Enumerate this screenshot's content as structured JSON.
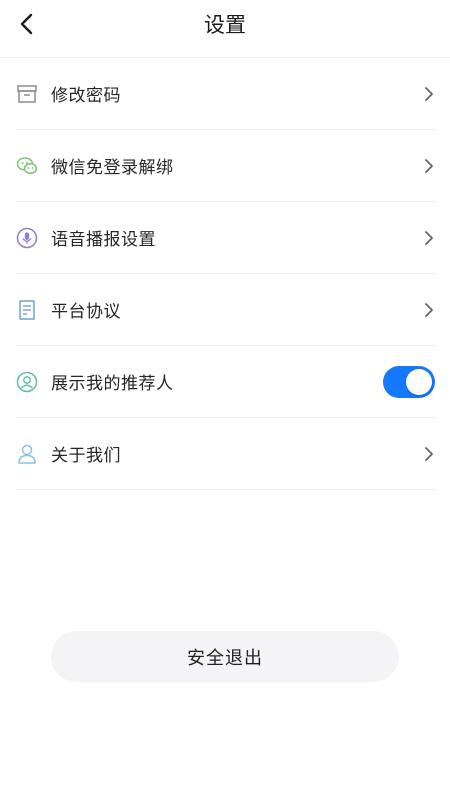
{
  "header": {
    "title": "设置",
    "back_icon": "chevron-left-icon"
  },
  "settings": [
    {
      "label": "修改密码",
      "icon": "storage-box-icon",
      "control": "chevron"
    },
    {
      "label": "微信免登录解绑",
      "icon": "wechat-icon",
      "control": "chevron"
    },
    {
      "label": "语音播报设置",
      "icon": "microphone-icon",
      "control": "chevron"
    },
    {
      "label": "平台协议",
      "icon": "document-icon",
      "control": "chevron"
    },
    {
      "label": "展示我的推荐人",
      "icon": "user-circle-icon",
      "control": "toggle",
      "toggle_on": true
    },
    {
      "label": "关于我们",
      "icon": "user-icon",
      "control": "chevron"
    }
  ],
  "logout_label": "安全退出",
  "colors": {
    "accent": "#1677ff",
    "wechat_green": "#7cc576",
    "mic_purple": "#8a82d6",
    "doc_blue": "#6ea3d8",
    "user_green": "#5fbf9f",
    "user_blue": "#8cc4e8",
    "box_gray": "#8c8c8c"
  }
}
